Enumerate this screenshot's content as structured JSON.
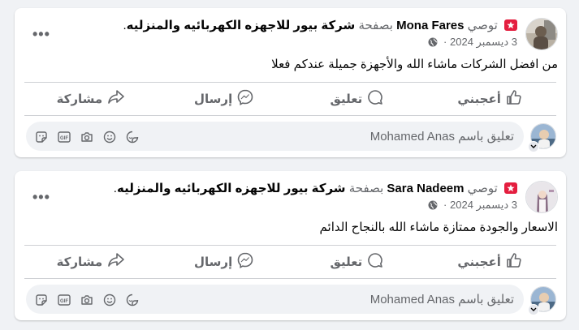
{
  "posts": [
    {
      "recommends": "توصي",
      "author": "Mona Fares",
      "via": "بصفحة",
      "page_name": "شركة بيور للاجهزه الكهربائيه والمنزليه",
      "trailing": ".",
      "date": "3 ديسمبر 2024",
      "text": "من افضل الشركات ماشاء الله والأجهزة جميلة عندكم فعلا"
    },
    {
      "recommends": "توصي",
      "author": "Sara Nadeem",
      "via": "بصفحة",
      "page_name": "شركة بيور للاجهزه الكهربائيه والمنزليه",
      "trailing": ".",
      "date": "3 ديسمبر 2024",
      "text": "الاسعار والجودة ممتازة ماشاء الله بالنجاح الدائم"
    }
  ],
  "actions": {
    "like": "أعجبني",
    "comment": "تعليق",
    "send": "إرسال",
    "share": "مشاركة"
  },
  "comment_placeholder": "تعليق باسم Mohamed Anas",
  "more_label": "•••",
  "colors": {
    "badge": "#e41e3f",
    "secondary_text": "#65676b",
    "background": "#f0f2f5"
  },
  "icons": {
    "actions": [
      "like-icon",
      "comment-icon",
      "send-icon",
      "share-icon"
    ],
    "composer": [
      "sticker-icon",
      "gif-icon",
      "camera-icon",
      "emoji-icon",
      "avatar-sticker-icon"
    ]
  }
}
